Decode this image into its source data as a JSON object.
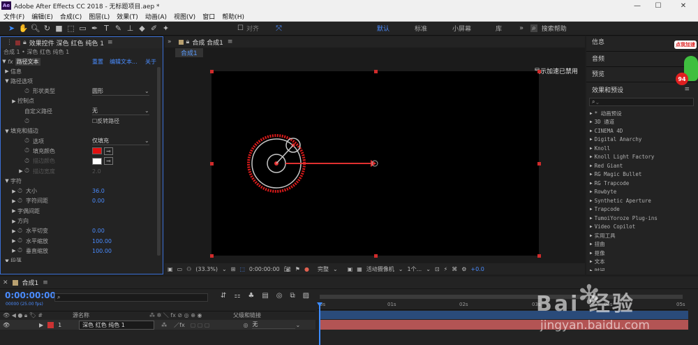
{
  "app": {
    "title": "Adobe After Effects CC 2018 - 无标题项目.aep *",
    "logo": "Ae"
  },
  "menu": [
    "文件(F)",
    "编辑(E)",
    "合成(C)",
    "图层(L)",
    "效果(T)",
    "动画(A)",
    "视图(V)",
    "窗口",
    "帮助(H)"
  ],
  "toolbar": {
    "align_label": "对齐",
    "workspaces": [
      "默认",
      "标准",
      "小屏幕",
      "库"
    ],
    "search_placeholder": "搜索帮助"
  },
  "effects_panel": {
    "tab": "效果控件 深色 红色 纯色 1",
    "sub": "合成 1 • 深色 红色 纯色 1",
    "fx_name": "路径文本",
    "fx_links": [
      "重置",
      "编辑文本...",
      "关于"
    ],
    "rows": [
      {
        "label": "信息",
        "indent": 1,
        "tri": "▶"
      },
      {
        "label": "路径选项",
        "indent": 1,
        "tri": "▼"
      },
      {
        "label": "形状类型",
        "indent": 3,
        "sw": true,
        "value": "圆形",
        "dropdown": true
      },
      {
        "label": "控制点",
        "indent": 2,
        "tri": "▶"
      },
      {
        "label": "自定义路径",
        "indent": 3,
        "value": "无",
        "dropdown": true
      },
      {
        "label": "",
        "indent": 3,
        "sw": true,
        "checkbox": "反转路径"
      },
      {
        "label": "填充和描边",
        "indent": 1,
        "tri": "▼"
      },
      {
        "label": "选项",
        "indent": 3,
        "sw": true,
        "value": "仅填充",
        "dropdown": true
      },
      {
        "label": "填充颜色",
        "indent": 3,
        "sw": true,
        "color": "#e01010"
      },
      {
        "label": "描边颜色",
        "indent": 3,
        "sw": true,
        "color": "#ffffff",
        "dim": true
      },
      {
        "label": "描边宽度",
        "indent": 3,
        "tri": "▶",
        "sw": true,
        "value": "2.0",
        "dim": true
      },
      {
        "label": "字符",
        "indent": 1,
        "tri": "▼"
      },
      {
        "label": "大小",
        "indent": 2,
        "tri": "▶",
        "sw": true,
        "value": "36.0",
        "blue": true
      },
      {
        "label": "字符间距",
        "indent": 2,
        "tri": "▶",
        "sw": true,
        "value": "0.00",
        "blue": true
      },
      {
        "label": "字偶间距",
        "indent": 2,
        "tri": "▶"
      },
      {
        "label": "方向",
        "indent": 2,
        "tri": "▶"
      },
      {
        "label": "水平切变",
        "indent": 2,
        "tri": "▶",
        "sw": true,
        "value": "0.00",
        "blue": true
      },
      {
        "label": "水平缩放",
        "indent": 2,
        "tri": "▶",
        "sw": true,
        "value": "100.00",
        "blue": true
      },
      {
        "label": "垂直缩放",
        "indent": 2,
        "tri": "▶",
        "sw": true,
        "value": "100.00",
        "blue": true
      },
      {
        "label": "段落",
        "indent": 1,
        "tri": "▼"
      }
    ]
  },
  "comp_panel": {
    "tab": "合成 合成1",
    "subtab": "合成1",
    "gpu_msg": "显示加速已禁用",
    "bottom": {
      "zoom": "(33.3%)",
      "time": "0:00:00:00",
      "quality": "完整",
      "camera": "活动摄像机",
      "views": "1个...",
      "exposure": "+0.0"
    }
  },
  "right_panel": {
    "items": [
      "信息",
      "音频",
      "预览"
    ],
    "effects_title": "效果和预设",
    "effects": [
      "* 动画预设",
      "3D 通道",
      "CINEMA 4D",
      "Digital Anarchy",
      "Knoll",
      "Knoll Light Factory",
      "Red Giant",
      "RG Magic Bullet",
      "RG Trapcode",
      "Rowbyte",
      "Synthetic Aperture",
      "Trapcode",
      "TumoiYoroze Plug-ins",
      "Video Copilot",
      "实用工具",
      "扭曲",
      "抠像",
      "文本",
      "时间"
    ]
  },
  "timeline": {
    "tab": "合成1",
    "timecode": "0:00:00:00",
    "fps": "00000 (25.00 fps)",
    "col_name": "源名称",
    "col_parent": "父级和链接",
    "layer": {
      "num": "1",
      "name": "深色 红色 纯色 1",
      "parent": "无"
    },
    "ticks": [
      "0s",
      "01s",
      "02s",
      "03s",
      "04s",
      "05s"
    ]
  },
  "watermark": {
    "text": "Bai 经验",
    "url": "jingyan.baidu.com"
  },
  "badge": {
    "text": "点我加速",
    "num": "94"
  }
}
